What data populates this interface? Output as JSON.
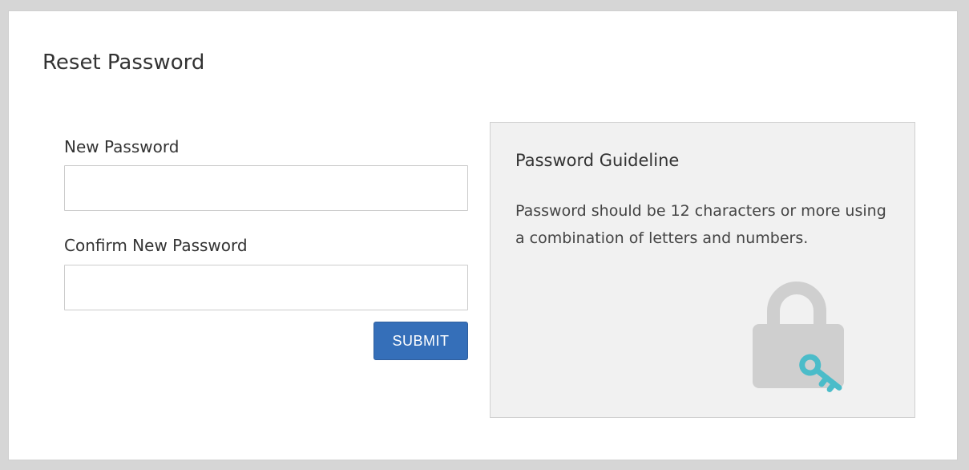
{
  "page": {
    "title": "Reset Password"
  },
  "form": {
    "new_password_label": "New Password",
    "new_password_value": "",
    "confirm_password_label": "Confirm New Password",
    "confirm_password_value": "",
    "submit_label": "SUBMIT"
  },
  "guideline": {
    "title": "Password Guideline",
    "text": "Password should be 12 characters or more using a combination of letters and numbers.",
    "icon": "lock-with-key-icon"
  },
  "colors": {
    "accent": "#356fb9",
    "key": "#4bbcc9",
    "lock": "#cfcfcf",
    "panel_bg": "#f1f1f1",
    "page_bg": "#d6d6d6"
  }
}
